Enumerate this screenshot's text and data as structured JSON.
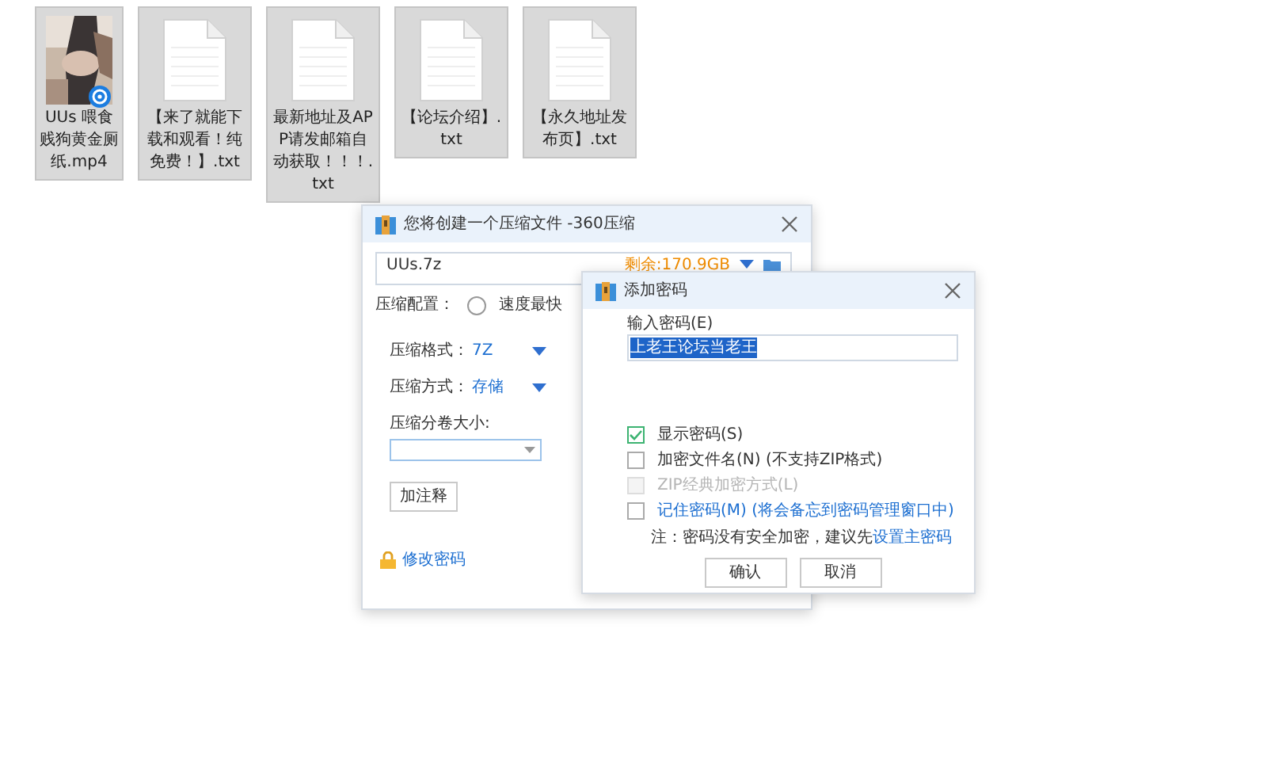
{
  "desktop_files": [
    {
      "kind": "video",
      "label": "UUs 喂食贱狗黄金厕纸.mp4",
      "selected": true
    },
    {
      "kind": "text",
      "label": "【来了就能下载和观看！纯免费！】.txt",
      "selected": true
    },
    {
      "kind": "text",
      "label": "最新地址及APP请发邮箱自动获取！！！.txt",
      "selected": true
    },
    {
      "kind": "text",
      "label": "【论坛介绍】.txt",
      "selected": true
    },
    {
      "kind": "text",
      "label": "【永久地址发布页】.txt",
      "selected": true
    }
  ],
  "main_dialog": {
    "title": "您将创建一个压缩文件 -360压缩",
    "filename": "UUs.7z",
    "free_space": "剩余:170.9GB",
    "config_label": "压缩配置：",
    "config_options": [
      {
        "label": "速度最快",
        "selected": false
      }
    ],
    "format_label": "压缩格式：",
    "format_value": "7Z",
    "method_label": "压缩方式：",
    "method_value": "存储",
    "split_label": "压缩分卷大小:",
    "comment_button": "加注释",
    "change_password_link": "修改密码"
  },
  "password_dialog": {
    "title": "添加密码",
    "input_label": "输入密码(E)",
    "password": "上老王论坛当老王",
    "options": [
      {
        "label": "显示密码(S)",
        "checked": true,
        "disabled": false,
        "link": false
      },
      {
        "label": "加密文件名(N) (不支持ZIP格式)",
        "checked": false,
        "disabled": false,
        "link": false
      },
      {
        "label": "ZIP经典加密方式(L)",
        "checked": false,
        "disabled": true,
        "link": false
      },
      {
        "label": "记住密码(M) (将会备忘到密码管理窗口中)",
        "checked": false,
        "disabled": false,
        "link": true
      }
    ],
    "note": "注：密码没有安全加密，建议先",
    "note_link": "设置主密码",
    "buttons": [
      "确认",
      "取消"
    ]
  }
}
